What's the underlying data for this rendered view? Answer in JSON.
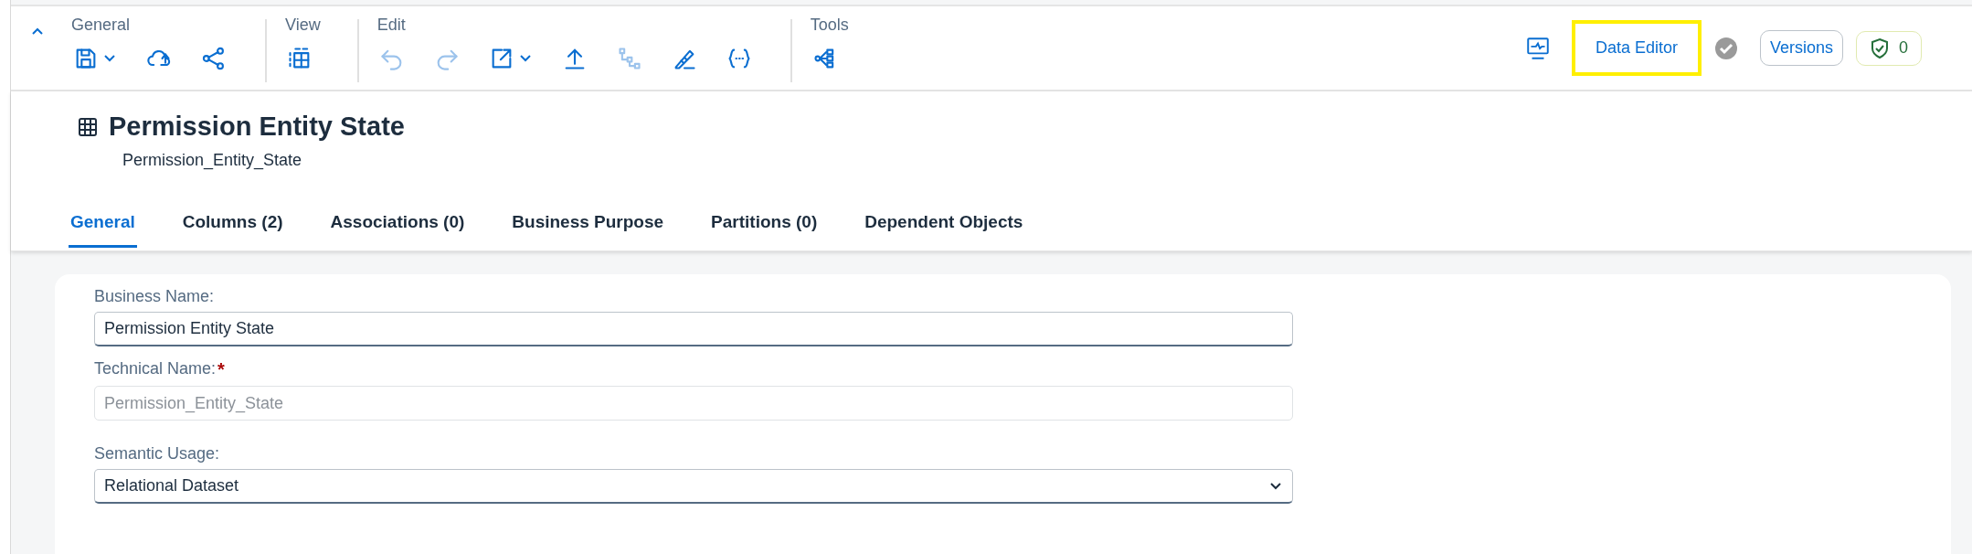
{
  "toolbar": {
    "collapsed": false,
    "groups": [
      {
        "label": "General",
        "items": [
          {
            "disabled": false,
            "dropdown": true
          },
          {
            "disabled": false,
            "dropdown": false
          },
          {
            "disabled": false,
            "dropdown": false
          }
        ]
      },
      {
        "label": "View",
        "items": [
          {
            "disabled": false,
            "dropdown": false
          }
        ]
      },
      {
        "label": "Edit",
        "items": [
          {
            "disabled": true,
            "dropdown": false
          },
          {
            "disabled": true,
            "dropdown": false
          },
          {
            "disabled": false,
            "dropdown": true
          },
          {
            "disabled": false,
            "dropdown": false
          },
          {
            "disabled": true,
            "dropdown": false
          },
          {
            "disabled": false,
            "dropdown": false
          },
          {
            "disabled": false,
            "dropdown": false
          }
        ]
      },
      {
        "label": "Tools",
        "items": [
          {
            "disabled": false,
            "dropdown": false
          }
        ]
      }
    ],
    "data_editor": {
      "label": "Data Editor",
      "highlighted": true
    },
    "versions": {
      "label": "Versions"
    },
    "validation": {
      "count": "0"
    }
  },
  "header": {
    "title": "Permission Entity State",
    "subtitle": "Permission_Entity_State"
  },
  "tabs": [
    {
      "label": "General",
      "selected": true
    },
    {
      "label": "Columns (2)",
      "selected": false
    },
    {
      "label": "Associations (0)",
      "selected": false
    },
    {
      "label": "Business Purpose",
      "selected": false
    },
    {
      "label": "Partitions (0)",
      "selected": false
    },
    {
      "label": "Dependent Objects",
      "selected": false
    }
  ],
  "form": [
    {
      "kind": "input",
      "label": "Business Name:",
      "value": "Permission Entity State",
      "disabled": false
    },
    {
      "kind": "input",
      "label": "Technical Name:",
      "value": "Permission_Entity_State",
      "required_mark": "*",
      "disabled": true
    },
    {
      "kind": "select",
      "label": "Semantic Usage:",
      "value": "Relational Dataset",
      "disabled": false
    }
  ]
}
